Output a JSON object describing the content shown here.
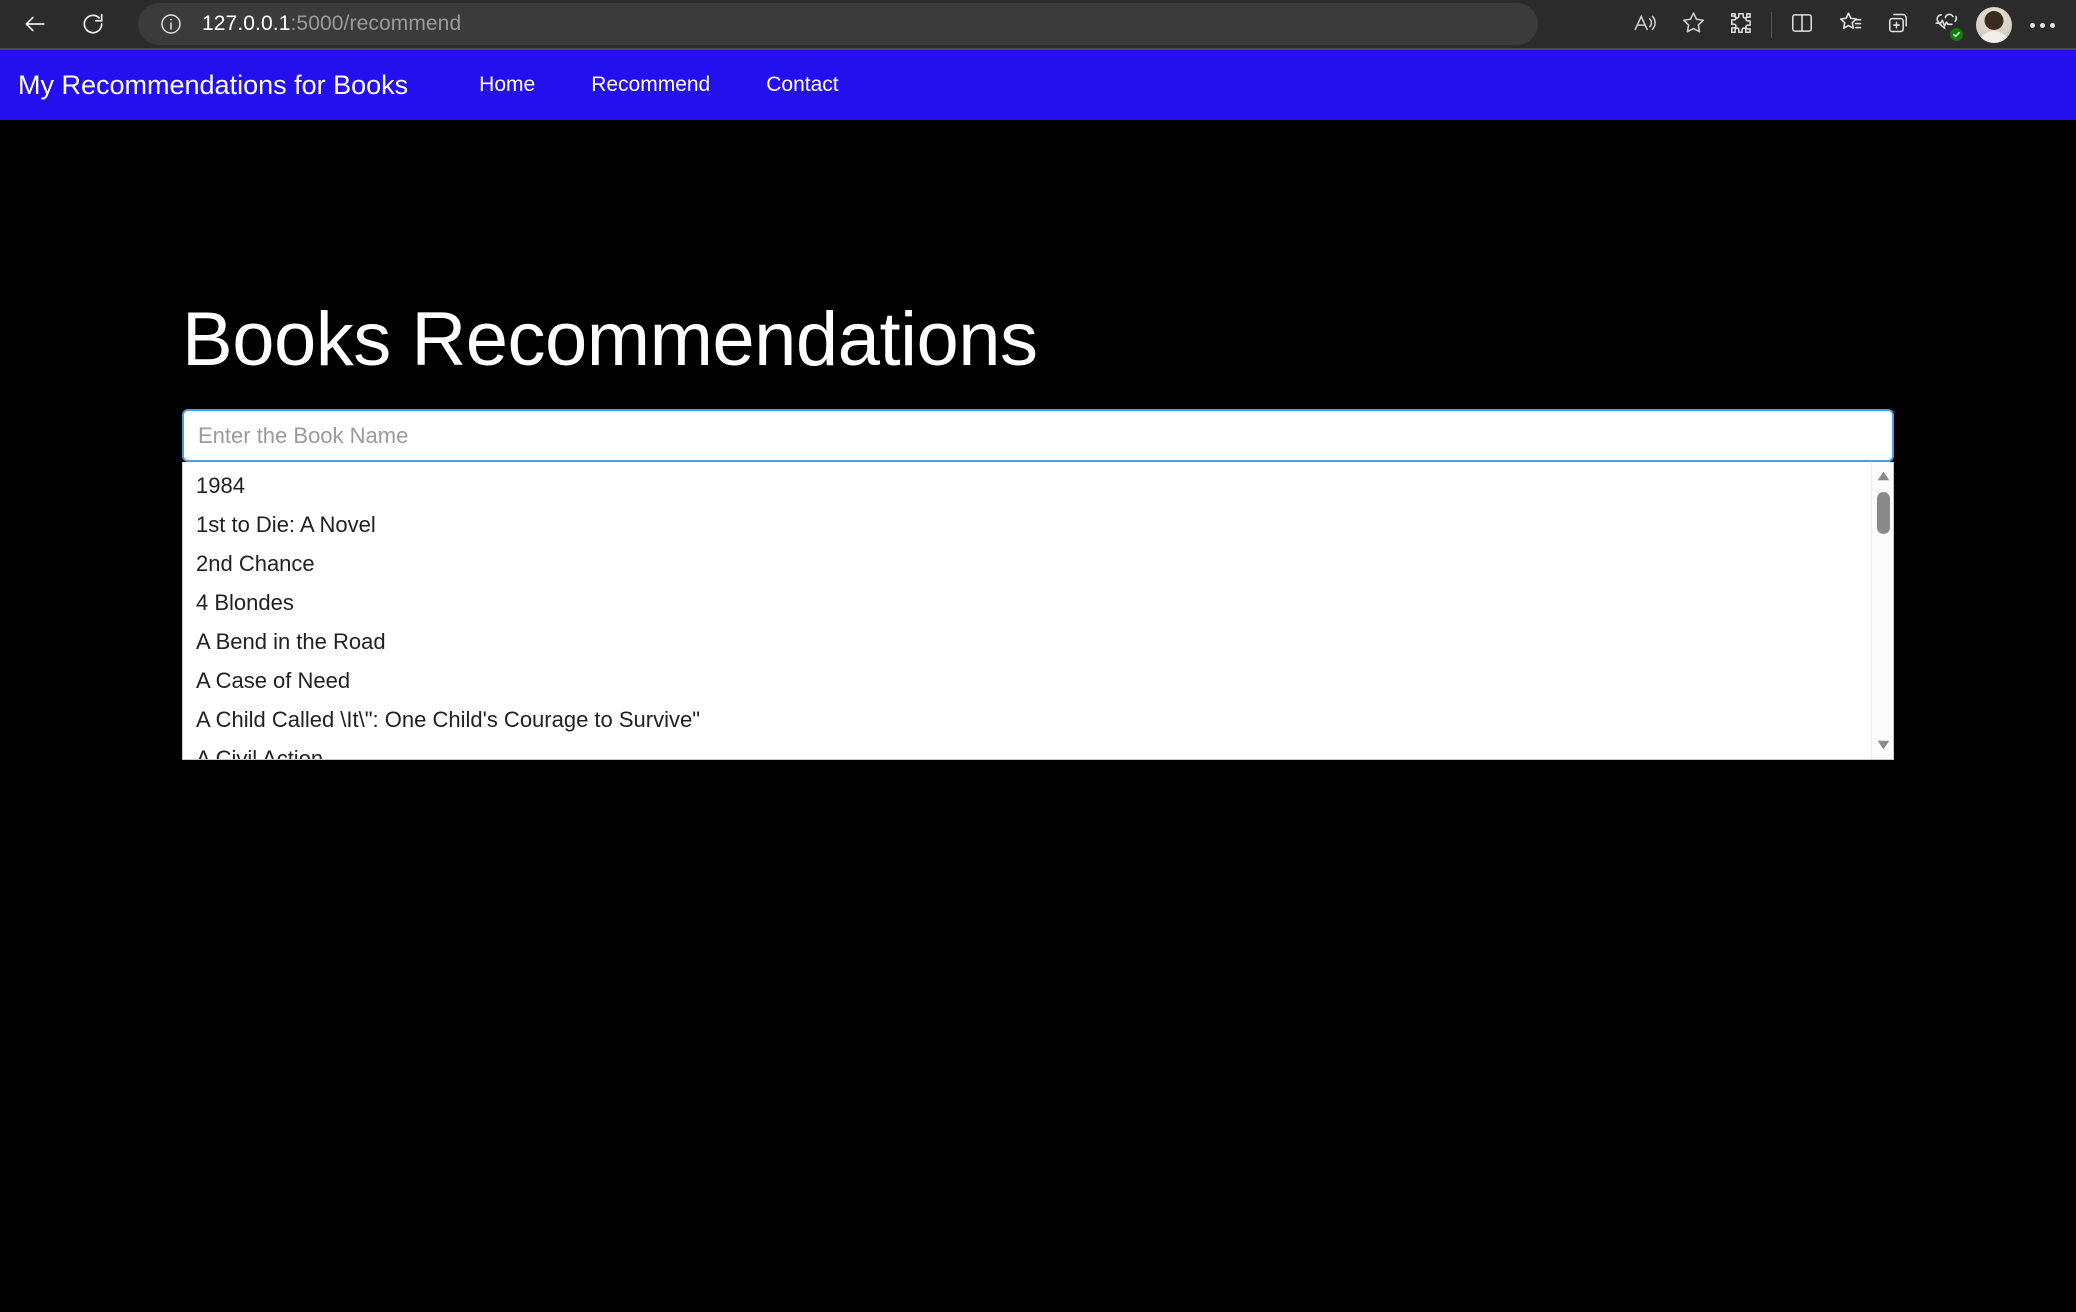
{
  "browser": {
    "back_icon": "back-arrow-icon",
    "reload_icon": "reload-icon",
    "site_info_icon": "site-info-icon",
    "url_host": "127.0.0.1",
    "url_path": ":5000/recommend",
    "toolbar_icons": [
      "read-aloud-icon",
      "favorite-star-icon",
      "extensions-puzzle-icon",
      "split-screen-icon",
      "favorites-list-icon",
      "collections-add-icon",
      "browser-essentials-icon",
      "profile-avatar",
      "settings-more-icon"
    ]
  },
  "navbar": {
    "brand": "My Recommendations for Books",
    "links": [
      {
        "label": "Home"
      },
      {
        "label": "Recommend"
      },
      {
        "label": "Contact"
      }
    ],
    "background_color": "#2410ee",
    "text_color": "#ffffff"
  },
  "main": {
    "title": "Books Recommendations",
    "search": {
      "value": "",
      "placeholder": "Enter the Book Name",
      "focus_border_color": "#4a9fe0"
    },
    "suggestions": [
      {
        "label": "1984"
      },
      {
        "label": "1st to Die: A Novel"
      },
      {
        "label": "2nd Chance"
      },
      {
        "label": "4 Blondes"
      },
      {
        "label": "A Bend in the Road"
      },
      {
        "label": "A Case of Need"
      },
      {
        "label": "A Child Called \\It\\\": One Child's Courage to Survive\""
      },
      {
        "label": "A Civil Action"
      }
    ],
    "background_color": "#000000"
  }
}
